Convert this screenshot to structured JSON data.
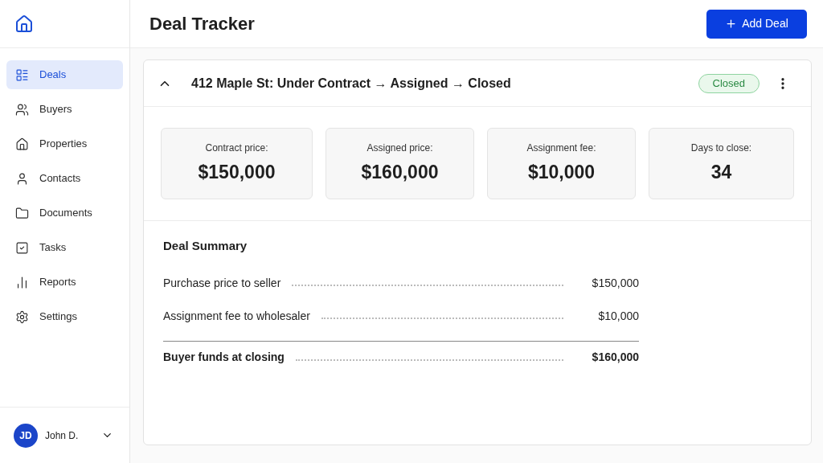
{
  "sidebar": {
    "items": [
      {
        "label": "Deals",
        "selected": true
      },
      {
        "label": "Buyers",
        "selected": false
      },
      {
        "label": "Properties",
        "selected": false
      },
      {
        "label": "Contacts",
        "selected": false
      },
      {
        "label": "Documents",
        "selected": false
      },
      {
        "label": "Tasks",
        "selected": false
      },
      {
        "label": "Reports",
        "selected": false
      },
      {
        "label": "Settings",
        "selected": false
      }
    ],
    "user": {
      "initials": "JD",
      "name": "John D."
    }
  },
  "header": {
    "title": "Deal Tracker",
    "add_button": "Add Deal"
  },
  "deal": {
    "expanded": true,
    "title": "412 Maple St: Under Contract → Assigned → Closed",
    "status": "Closed",
    "stats": [
      {
        "label": "Contract price:",
        "value": "$150,000"
      },
      {
        "label": "Assigned price:",
        "value": "$160,000"
      },
      {
        "label": "Assignment fee:",
        "value": "$10,000"
      },
      {
        "label": "Days to close:",
        "value": "34"
      }
    ],
    "summary": {
      "title": "Deal Summary",
      "rows": [
        {
          "kind": "line",
          "label": "Purchase price to seller",
          "value": "$150,000"
        },
        {
          "kind": "line",
          "label": "Assignment fee to wholesaler",
          "value": "$10,000"
        },
        {
          "kind": "total",
          "label": "Buyer funds at closing",
          "value": "$160,000"
        }
      ]
    }
  }
}
